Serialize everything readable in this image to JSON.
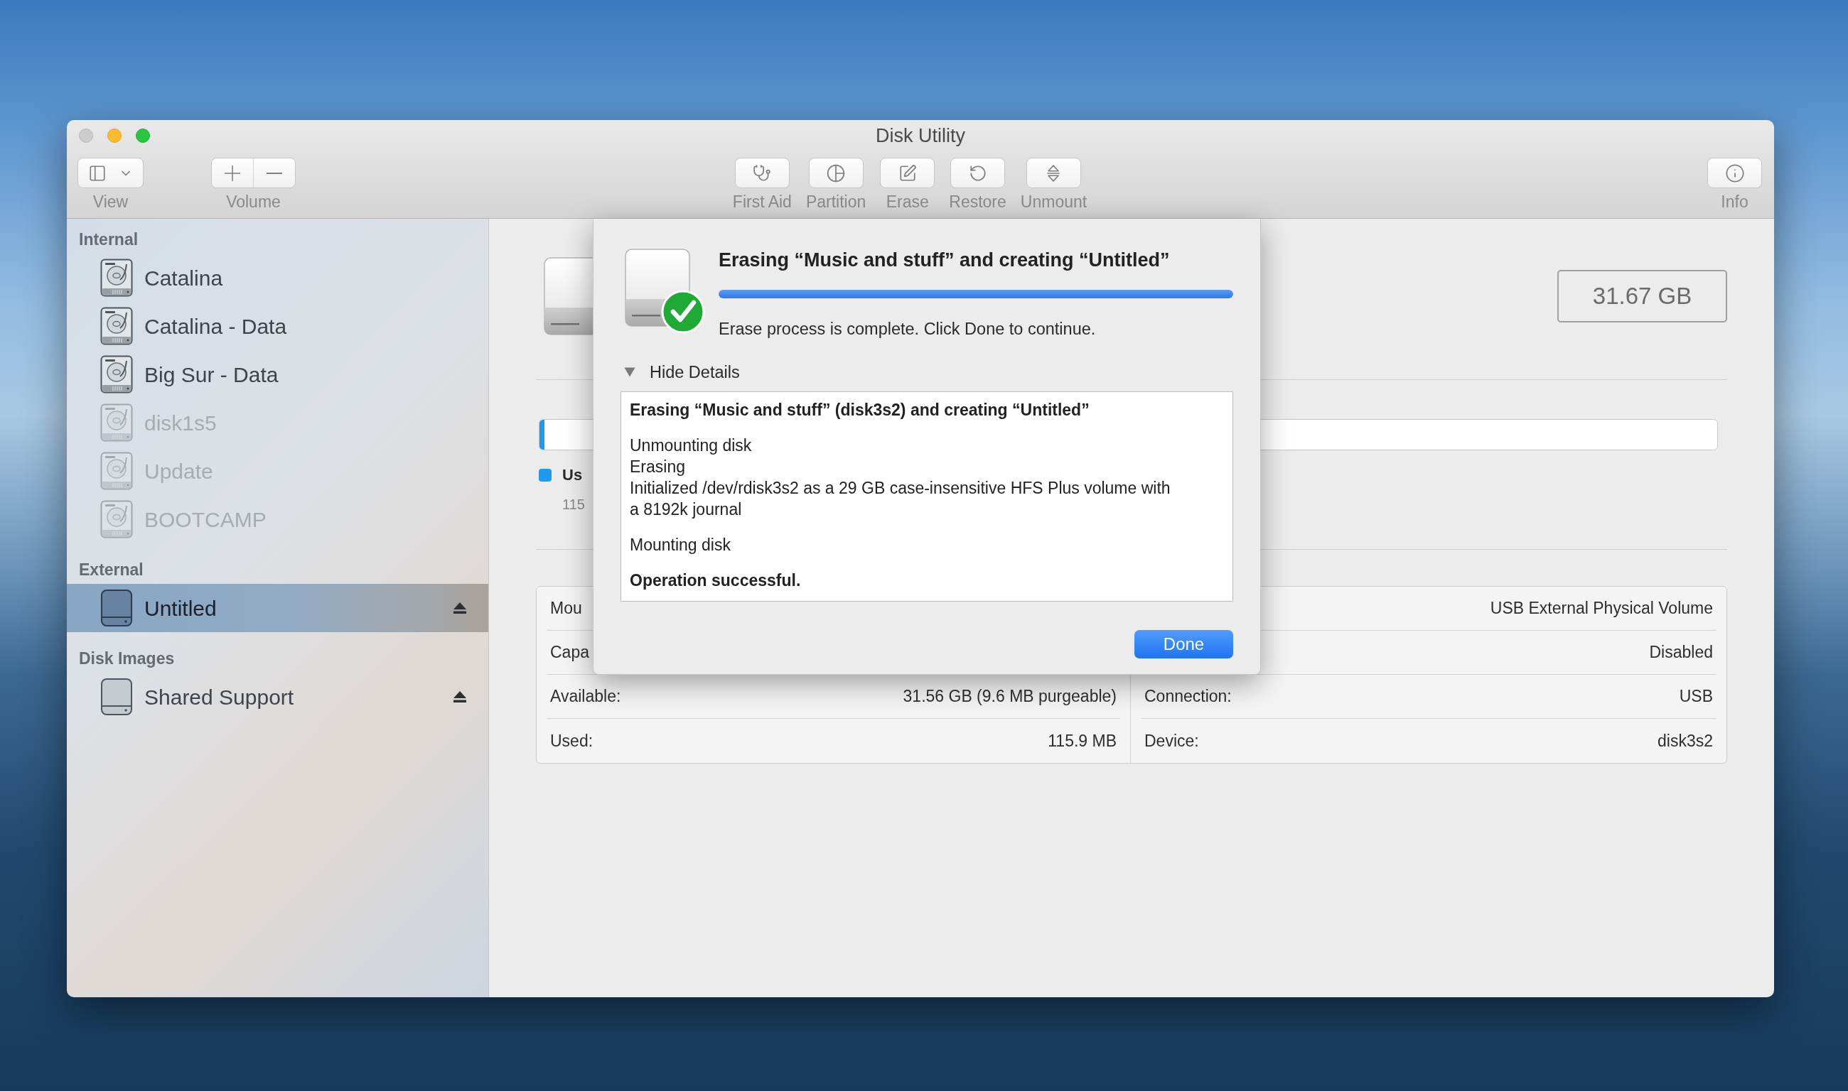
{
  "window": {
    "title": "Disk Utility"
  },
  "toolbar": {
    "left": [
      {
        "label": "View",
        "kind": "menu"
      },
      {
        "label": "Volume",
        "kind": "segmented"
      }
    ],
    "center": [
      {
        "label": "First Aid",
        "kind": "button"
      },
      {
        "label": "Partition",
        "kind": "button"
      },
      {
        "label": "Erase",
        "kind": "button"
      },
      {
        "label": "Restore",
        "kind": "button"
      },
      {
        "label": "Unmount",
        "kind": "button"
      }
    ],
    "right": [
      {
        "label": "Info",
        "kind": "button"
      }
    ]
  },
  "sidebar": {
    "sections": [
      {
        "title": "Internal",
        "items": [
          {
            "name": "Catalina",
            "kind": "internal",
            "mounted": true,
            "selected": false,
            "ejectable": false
          },
          {
            "name": "Catalina - Data",
            "kind": "internal",
            "mounted": true,
            "selected": false,
            "ejectable": false
          },
          {
            "name": "Big Sur - Data",
            "kind": "internal",
            "mounted": true,
            "selected": false,
            "ejectable": false
          },
          {
            "name": "disk1s5",
            "kind": "internal",
            "mounted": false,
            "selected": false,
            "ejectable": false
          },
          {
            "name": "Update",
            "kind": "internal",
            "mounted": false,
            "selected": false,
            "ejectable": false
          },
          {
            "name": "BOOTCAMP",
            "kind": "internal",
            "mounted": false,
            "selected": false,
            "ejectable": false
          }
        ]
      },
      {
        "title": "External",
        "items": [
          {
            "name": "Untitled",
            "kind": "external",
            "mounted": true,
            "selected": true,
            "ejectable": true
          }
        ]
      },
      {
        "title": "Disk Images",
        "items": [
          {
            "name": "Shared Support",
            "kind": "external",
            "mounted": true,
            "selected": false,
            "ejectable": true
          }
        ]
      }
    ]
  },
  "volume": {
    "capacity": "31.67 GB",
    "usage": {
      "level": 0.004,
      "legend": [
        {
          "label": "Us",
          "value": "115",
          "color": "#1e9bf0"
        }
      ]
    },
    "info": {
      "columns": [
        {
          "rows": [
            {
              "label": "Mou"
            },
            {
              "label": "Capa"
            },
            {
              "label": "Available:",
              "value": "31.56 GB (9.6 MB purgeable)"
            },
            {
              "label": "Used:",
              "value": "115.9 MB"
            }
          ]
        },
        {
          "rows": [
            {
              "value": "USB External Physical Volume"
            },
            {
              "value": "Disabled"
            },
            {
              "label": "Connection:",
              "value": "USB"
            },
            {
              "label": "Device:",
              "value": "disk3s2"
            }
          ]
        }
      ]
    }
  },
  "sheet": {
    "title": "Erasing “Music and stuff” and creating “Untitled”",
    "progress": {
      "level": 1
    },
    "status": "Erase process is complete. Click Done to continue.",
    "details": {
      "label": "Hide Details",
      "expanded": true,
      "blocks": [
        {
          "lines": [
            {
              "text": "Erasing “Music and stuff” (disk3s2) and creating “Untitled”",
              "bold": true
            }
          ]
        },
        {
          "lines": [
            {
              "text": "Unmounting disk",
              "bold": false
            },
            {
              "text": "Erasing",
              "bold": false
            },
            {
              "text": "Initialized /dev/rdisk3s2 as a 29 GB case-insensitive HFS Plus volume with a 8192k journal",
              "bold": false
            }
          ]
        },
        {
          "lines": [
            {
              "text": "Mounting disk",
              "bold": false
            }
          ]
        },
        {
          "lines": [
            {
              "text": "Operation successful.",
              "bold": true
            }
          ]
        }
      ]
    },
    "buttons": [
      {
        "label": "Done",
        "default": true
      }
    ]
  }
}
